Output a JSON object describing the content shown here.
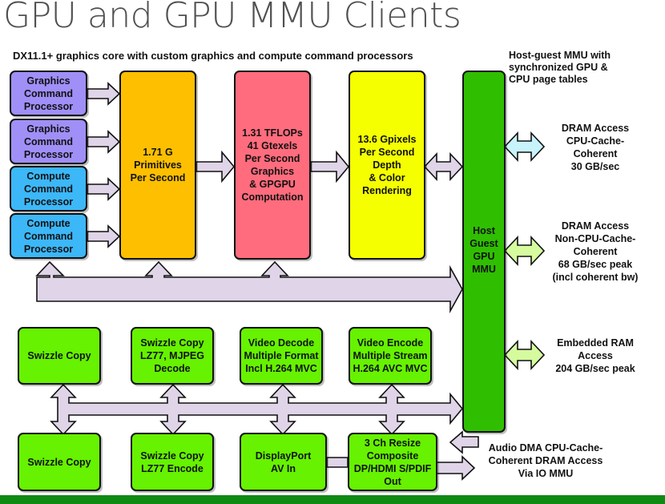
{
  "title": "GPU and GPU MMU Clients",
  "subtitle": "DX11.1+ graphics core with custom graphics and compute command processors",
  "mmu_note": "Host-guest MMU with\nsynchronized GPU &\nCPU page tables",
  "colors": {
    "graphics_cp": "#9f8ff7",
    "compute_cp": "#3cb7f7",
    "primitives": "#fdbf00",
    "shader": "#ff6c7d",
    "rop": "#f5ff00",
    "mmu": "#2fbf00",
    "clients": "#66f200",
    "arrow_fill": "#e0d4e8",
    "dram_coherent_arrow": "#c8f3fb",
    "dram_noncoherent_arrow": "#d6fb9f",
    "footer": "#0f8a12"
  },
  "command_processors": [
    {
      "label": "Graphics\nCommand\nProcessor",
      "type": "graphics"
    },
    {
      "label": "Graphics\nCommand\nProcessor",
      "type": "graphics"
    },
    {
      "label": "Compute\nCommand\nProcessor",
      "type": "compute"
    },
    {
      "label": "Compute\nCommand\nProcessor",
      "type": "compute"
    }
  ],
  "pipeline": {
    "primitives": "1.71 G\nPrimitives\nPer Second",
    "shader": "1.31 TFLOPs\n41 Gtexels\nPer Second\nGraphics\n& GPGPU\nComputation",
    "rop": "13.6 Gpixels\nPer Second\nDepth\n& Color\nRendering"
  },
  "mmu": {
    "label": "Host\nGuest\nGPU\nMMU"
  },
  "memory_access": [
    {
      "label": "DRAM Access\nCPU-Cache-\nCoherent\n30 GB/sec"
    },
    {
      "label": "DRAM Access\nNon-CPU-Cache-\nCoherent\n68 GB/sec peak\n(incl coherent bw)"
    },
    {
      "label": "Embedded RAM\nAccess\n204 GB/sec peak"
    }
  ],
  "clients_top": [
    {
      "label": "Swizzle Copy"
    },
    {
      "label": "Swizzle Copy\nLZ77, MJPEG\nDecode"
    },
    {
      "label": "Video Decode\nMultiple Format\nIncl H.264 MVC"
    },
    {
      "label": "Video Encode\nMultiple Stream\nH.264 AVC MVC"
    }
  ],
  "clients_bottom": [
    {
      "label": "Swizzle Copy"
    },
    {
      "label": "Swizzle Copy\nLZ77 Encode"
    },
    {
      "label": "DisplayPort\nAV In"
    },
    {
      "label": "3 Ch Resize\nComposite\nDP/HDMI S/PDIF\nOut"
    }
  ],
  "audio_note": "Audio DMA CPU-Cache-\nCoherent DRAM Access\nVia IO MMU"
}
